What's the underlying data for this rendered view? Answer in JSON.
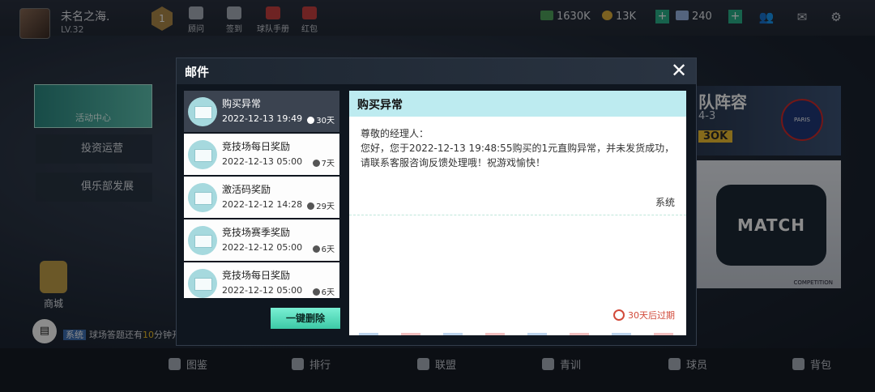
{
  "player": {
    "name": "未名之海.",
    "level": "LV.32",
    "rank_badge": "1"
  },
  "top_nav": [
    {
      "label": "顾问",
      "icon": "advisor-icon"
    },
    {
      "label": "签到",
      "icon": "checkin-icon"
    },
    {
      "label": "球队手册",
      "icon": "handbook-icon"
    },
    {
      "label": "红包",
      "icon": "red-packet-icon"
    }
  ],
  "resources": {
    "cash": "1630K",
    "coins": "13K",
    "diamonds": "240"
  },
  "side_menu": {
    "event_center": "活动中心",
    "investment": "投资运营",
    "club_dev": "俱乐部发展",
    "shop": "商城"
  },
  "ticker": {
    "tag": "系统",
    "prefix": "球场答题还有",
    "highlight": "10",
    "suffix": "分钟开"
  },
  "right_panel": {
    "lineup_title": "队阵容",
    "formation": "4-3",
    "lineup_badge": "3OK",
    "psg_text": "PARIS",
    "match_title": "MATCH",
    "match_caption": "COMPETITION"
  },
  "bottom_nav": [
    "图鉴",
    "排行",
    "联盟",
    "青训",
    "球员",
    "背包"
  ],
  "mail": {
    "title": "邮件",
    "close": "✕",
    "delete_all": "一键删除",
    "items": [
      {
        "title": "购买异常",
        "date": "2022-12-13 19:49",
        "expire": "30天"
      },
      {
        "title": "竞技场每日奖励",
        "date": "2022-12-13 05:00",
        "expire": "7天"
      },
      {
        "title": "激活码奖励",
        "date": "2022-12-12 14:28",
        "expire": "29天"
      },
      {
        "title": "竞技场赛季奖励",
        "date": "2022-12-12 05:00",
        "expire": "6天"
      },
      {
        "title": "竞技场每日奖励",
        "date": "2022-12-12 05:00",
        "expire": "6天"
      }
    ],
    "detail": {
      "subject": "购买异常",
      "greeting": "尊敬的经理人：",
      "body": "  您好，您于2022-12-13 19:48:55购买的1元直购异常，并未发货成功，请联系客服咨询反馈处理哦！祝游戏愉快！",
      "sender": "系统",
      "expiry": "30天后过期"
    }
  },
  "colors": {
    "accent": "#3cc9a6",
    "subject_bar": "#bdebf0",
    "expiry": "#d24a3a",
    "active_item": "#3b4350"
  }
}
